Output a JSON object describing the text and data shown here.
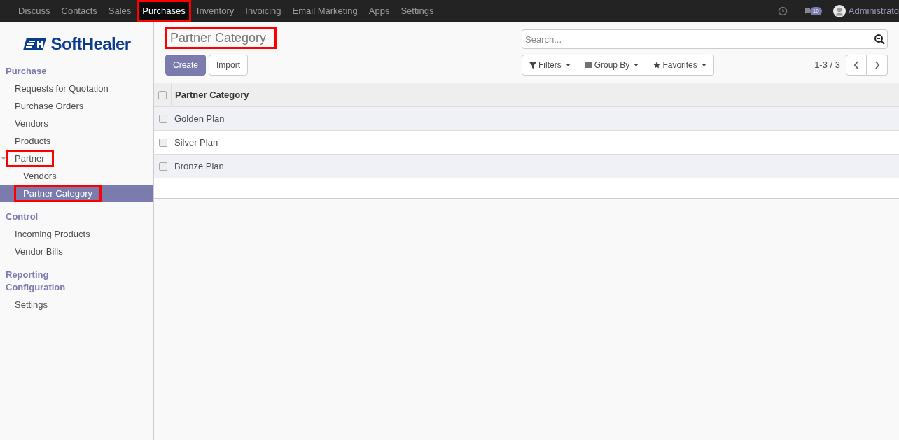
{
  "top_nav": {
    "items": [
      {
        "label": "Discuss",
        "selected": false,
        "highlighted": false
      },
      {
        "label": "Contacts",
        "selected": false,
        "highlighted": false
      },
      {
        "label": "Sales",
        "selected": false,
        "highlighted": false
      },
      {
        "label": "Purchases",
        "selected": true,
        "highlighted": true
      },
      {
        "label": "Inventory",
        "selected": false,
        "highlighted": false
      },
      {
        "label": "Invoicing",
        "selected": false,
        "highlighted": false
      },
      {
        "label": "Email Marketing",
        "selected": false,
        "highlighted": false
      },
      {
        "label": "Apps",
        "selected": false,
        "highlighted": false
      },
      {
        "label": "Settings",
        "selected": false,
        "highlighted": false
      }
    ],
    "message_count": "10",
    "user": "Administrato"
  },
  "sidebar": {
    "logo": "SoftHealer",
    "sections": [
      {
        "title": "Purchase",
        "items": [
          {
            "label": "Requests for Quotation",
            "selected": false,
            "highlighted": false
          },
          {
            "label": "Purchase Orders",
            "selected": false,
            "highlighted": false
          },
          {
            "label": "Vendors",
            "selected": false,
            "highlighted": false
          },
          {
            "label": "Products",
            "selected": false,
            "highlighted": false
          },
          {
            "label": "Partner",
            "selected": false,
            "highlighted": true,
            "expanded": true,
            "children": [
              {
                "label": "Vendors",
                "selected": false,
                "highlighted": false
              },
              {
                "label": "Partner Category",
                "selected": true,
                "highlighted": true
              }
            ]
          }
        ]
      },
      {
        "title": "Control",
        "items": [
          {
            "label": "Incoming Products",
            "selected": false,
            "highlighted": false
          },
          {
            "label": "Vendor Bills",
            "selected": false,
            "highlighted": false
          }
        ]
      },
      {
        "title": "Reporting"
      },
      {
        "title": "Configuration",
        "items": [
          {
            "label": "Settings",
            "selected": false,
            "highlighted": false
          }
        ]
      }
    ]
  },
  "main": {
    "title": "Partner Category",
    "title_highlighted": true,
    "buttons": [
      {
        "label": "Create",
        "kind": "primary"
      },
      {
        "label": "Import",
        "kind": "secondary"
      }
    ],
    "search": {
      "placeholder": "Search..."
    },
    "filters": [
      {
        "label": "Filters",
        "kind": "filter"
      },
      {
        "label": "Group By",
        "kind": "group"
      },
      {
        "label": "Favorites",
        "kind": "star"
      }
    ],
    "pager": "1-3 / 3",
    "table": {
      "columns": [
        "Partner Category"
      ],
      "all_checked": false,
      "rows": [
        {
          "cells": [
            "Golden Plan"
          ],
          "checked": false
        },
        {
          "cells": [
            "Silver Plan"
          ],
          "checked": false
        },
        {
          "cells": [
            "Bronze Plan"
          ],
          "checked": false
        }
      ]
    }
  }
}
